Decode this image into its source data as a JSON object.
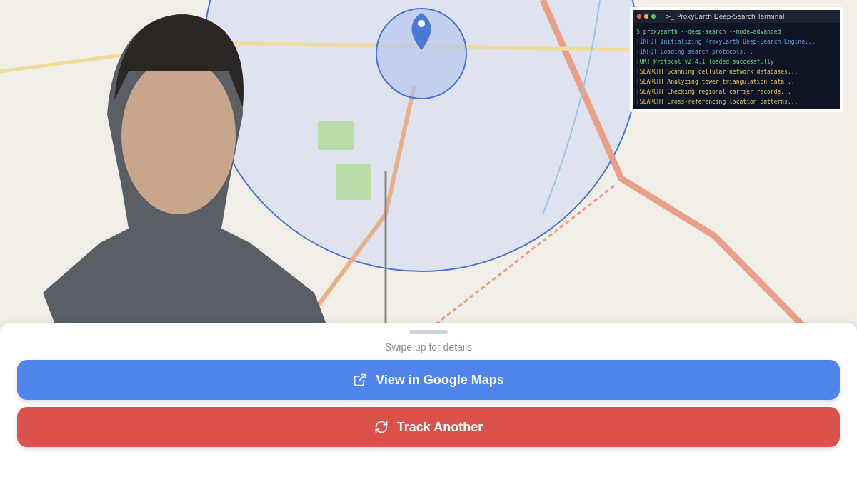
{
  "terminal": {
    "prompt": ">_",
    "title": "ProxyEarth Deep-Search Terminal",
    "lines": [
      {
        "kind": "command",
        "text": "$ proxyearth --deep-search --mode=advanced"
      },
      {
        "kind": "info",
        "text": "[INFO] Initializing ProxyEarth Deep-Search Engine..."
      },
      {
        "kind": "info",
        "text": "[INFO] Loading search protocols..."
      },
      {
        "kind": "ok",
        "text": "[OK] Protocol v2.4.1 loaded successfully"
      },
      {
        "kind": "search",
        "text": "[SEARCH] Scanning cellular network databases..."
      },
      {
        "kind": "search",
        "text": "[SEARCH] Analyzing tower triangulation data..."
      },
      {
        "kind": "search",
        "text": "[SEARCH] Checking regional carrier records..."
      },
      {
        "kind": "search",
        "text": "[SEARCH] Cross-referencing location patterns..."
      }
    ]
  },
  "sheet": {
    "hint": "Swipe up for details",
    "buttons": [
      {
        "kind": "maps",
        "label": "View in Google Maps"
      },
      {
        "kind": "track",
        "label": "Track Another"
      }
    ]
  }
}
